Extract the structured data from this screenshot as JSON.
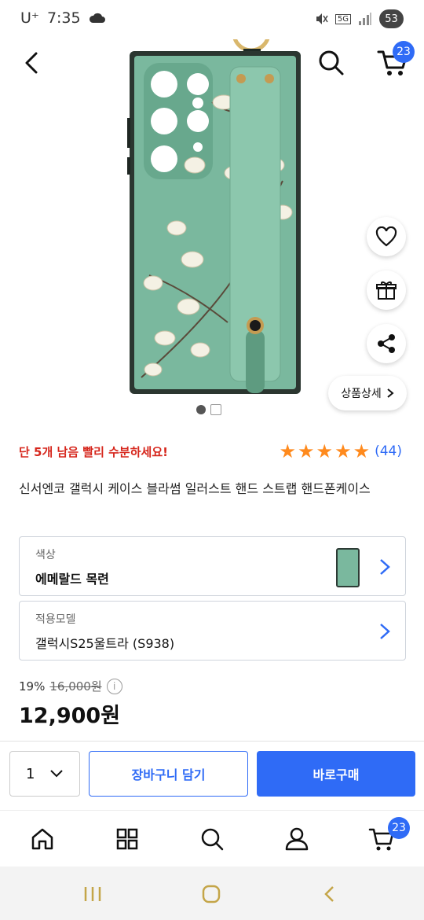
{
  "status_bar": {
    "carrier": "U⁺",
    "time": "7:35",
    "network": "5G",
    "battery": "53"
  },
  "header": {
    "cart_count": "23"
  },
  "gallery": {
    "detail_label": "상품상세"
  },
  "stock": {
    "message": "단 5개 남음 빨리 수분하세요!"
  },
  "rating": {
    "stars": 5,
    "count": "(44)"
  },
  "product": {
    "title": "신서엔코 갤럭시 케이스 블라썸 일러스트 핸드 스트랩 핸드폰케이스"
  },
  "options": {
    "color_label": "색상",
    "color_value": "에메랄드 목련",
    "model_label": "적용모델",
    "model_value": "갤럭시S25울트라 (S938)"
  },
  "pricing": {
    "discount": "19%",
    "original": "16,000원",
    "price": "12,900원"
  },
  "purchase": {
    "quantity": "1",
    "cart_label": "장바구니 담기",
    "buy_label": "바로구매"
  },
  "bottom_nav": {
    "cart_count": "23"
  },
  "colors": {
    "accent": "#2f6bf6",
    "alert": "#d6261c",
    "star": "#ff8a1d",
    "case_green": "#7ab89e"
  }
}
